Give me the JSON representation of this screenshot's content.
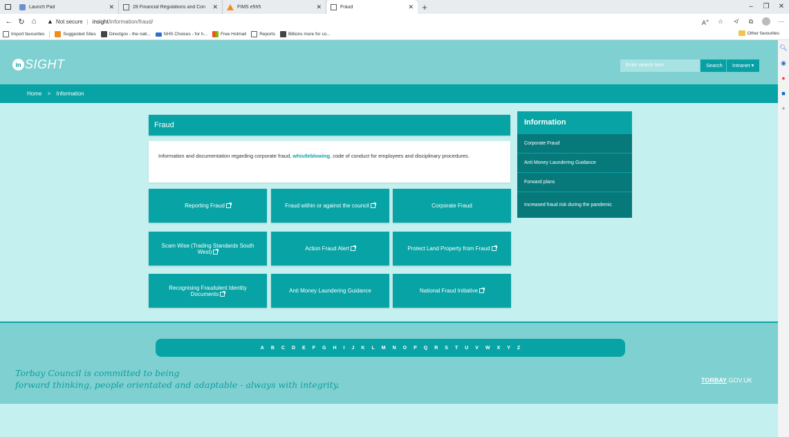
{
  "browser": {
    "tabs": [
      {
        "title": "Launch Pad"
      },
      {
        "title": "28 Financial Regulations and Con"
      },
      {
        "title": "FIMS e5h5"
      },
      {
        "title": "Fraud"
      }
    ],
    "new_tab": "+",
    "address": {
      "warning": "Not secure",
      "host": "insight",
      "path": "/information/fraud/"
    },
    "favourites": [
      "Import favourites",
      "Suggested Sites",
      "Directgov - the nati...",
      "NHS Choices - for h...",
      "Free Hotmail",
      "Reports",
      "Billions more for co..."
    ],
    "other_favourites": "Other favourites"
  },
  "header": {
    "logo_in": "in",
    "logo_text": "SIGHT",
    "search_placeholder": "Enter search term",
    "search_button": "Search",
    "intranet_button": "Intranet ▾"
  },
  "breadcrumb": {
    "home": "Home",
    "separator": ">",
    "current": "Information"
  },
  "main": {
    "title": "Fraud",
    "intro_before": "Information and documentation regarding corporate fraud, ",
    "intro_link": "whistleblowing",
    "intro_after": ", code of conduct for employees and disciplinary procedures.",
    "tiles": [
      {
        "label": "Reporting Fraud",
        "external": true
      },
      {
        "label": "Fraud within or against the council",
        "external": true
      },
      {
        "label": "Corporate Fraud",
        "external": false
      },
      {
        "label": "Scam Wise (Trading Standards South West)",
        "external": true
      },
      {
        "label": "Action Fraud Alert",
        "external": true
      },
      {
        "label": "Protect Land Property from Fraud",
        "external": true
      },
      {
        "label": "Recognising Fraudulent Identity Documents",
        "external": true
      },
      {
        "label": "Anti Money Laundering Guidance",
        "external": false
      },
      {
        "label": "National Fraud Initiative",
        "external": true
      }
    ]
  },
  "sidebar": {
    "title": "Information",
    "items": [
      "Corporate Fraud",
      "Anti Money Laundering Guidance",
      "Forward plans",
      "Increased fraud risk during the pandemic"
    ]
  },
  "footer": {
    "az": [
      "A",
      "B",
      "C",
      "D",
      "E",
      "F",
      "G",
      "H",
      "I",
      "J",
      "K",
      "L",
      "M",
      "N",
      "O",
      "P",
      "Q",
      "R",
      "S",
      "T",
      "U",
      "V",
      "W",
      "X",
      "Y",
      "Z"
    ],
    "tagline_1": "Torbay Council is committed to being",
    "tagline_2": "forward thinking, people orientated and adaptable - always with integrity.",
    "torbay": "TORBAY",
    "gov": ".GOV.UK"
  },
  "colors": {
    "teal": "#08a3a5",
    "dark_teal": "#08797b",
    "header_bg": "#7fd0d0",
    "page_bg": "#c5f0f0"
  }
}
